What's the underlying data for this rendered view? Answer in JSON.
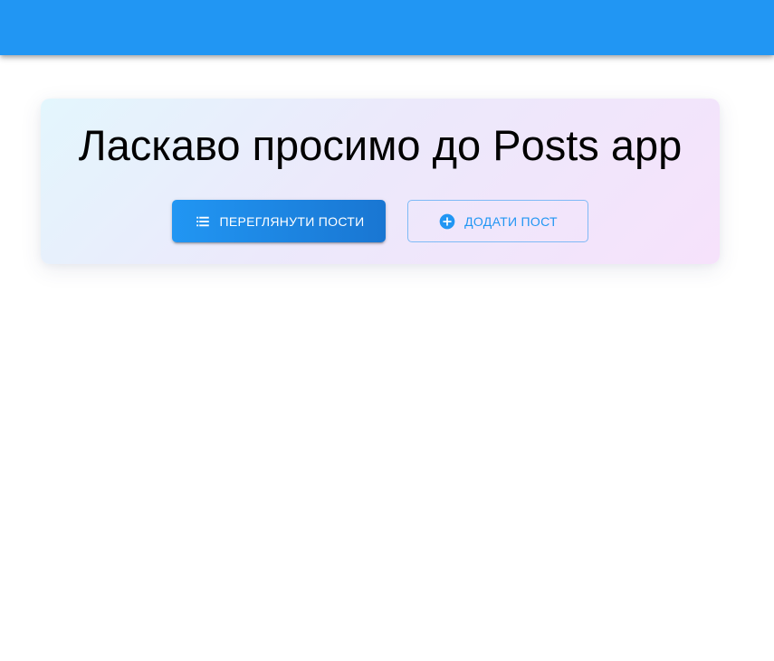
{
  "app_bar": {
    "color": "#2196f3"
  },
  "hero": {
    "title": "Ласкаво просимо до Posts app",
    "view_posts_button": {
      "label": "ПЕРЕГЛЯНУТИ ПОСТИ",
      "icon": "list-icon"
    },
    "add_post_button": {
      "label": "ДОДАТИ ПОСТ",
      "icon": "add-circle-icon"
    }
  },
  "colors": {
    "primary": "#2196f3",
    "primary_dark": "#1976d2",
    "title_text": "#000000"
  }
}
